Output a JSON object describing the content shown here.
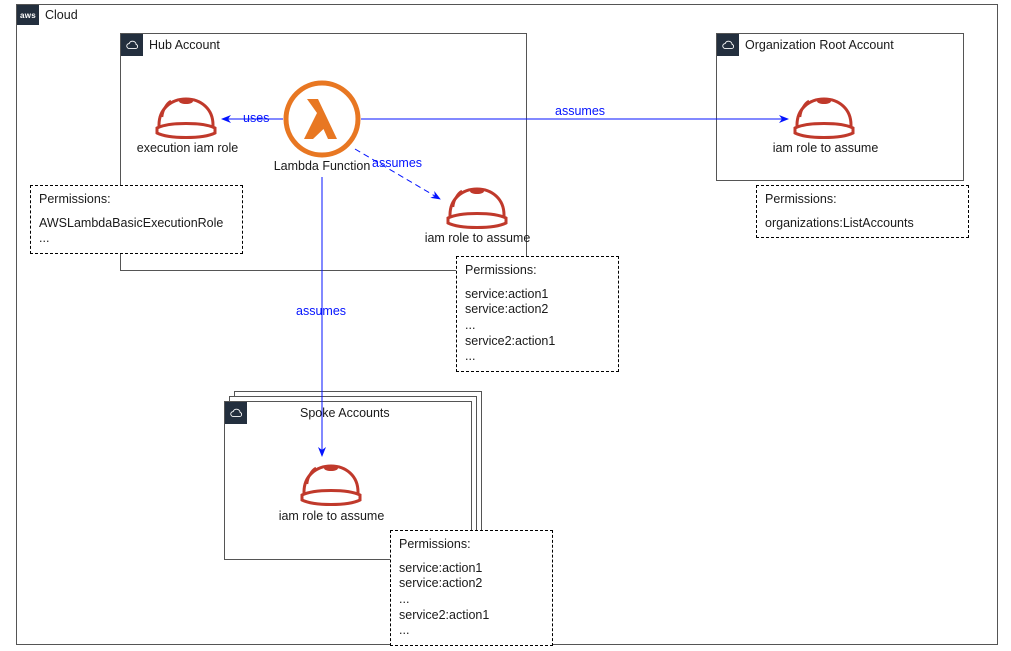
{
  "cloud": {
    "badge": "aws",
    "label": "Cloud"
  },
  "hub": {
    "title": "Hub Account",
    "lambda_label": "Lambda Function",
    "exec_role_label": "execution iam role",
    "assume_role_label": "iam role to assume",
    "exec_perm_header": "Permissions:",
    "exec_perm_body": "AWSLambdaBasicExecutionRole\n...",
    "assume_perm_header": "Permissions:",
    "assume_perm_body": "service:action1\nservice:action2\n...\nservice2:action1\n..."
  },
  "org": {
    "title": "Organization Root Account",
    "role_label": "iam role to assume",
    "perm_header": "Permissions:",
    "perm_body": "organizations:ListAccounts"
  },
  "spoke": {
    "title": "Spoke Accounts",
    "role_label": "iam role to assume",
    "perm_header": "Permissions:",
    "perm_body": "service:action1\nservice:action2\n...\nservice2:action1\n..."
  },
  "edges": {
    "uses": "uses",
    "assumes": "assumes"
  }
}
